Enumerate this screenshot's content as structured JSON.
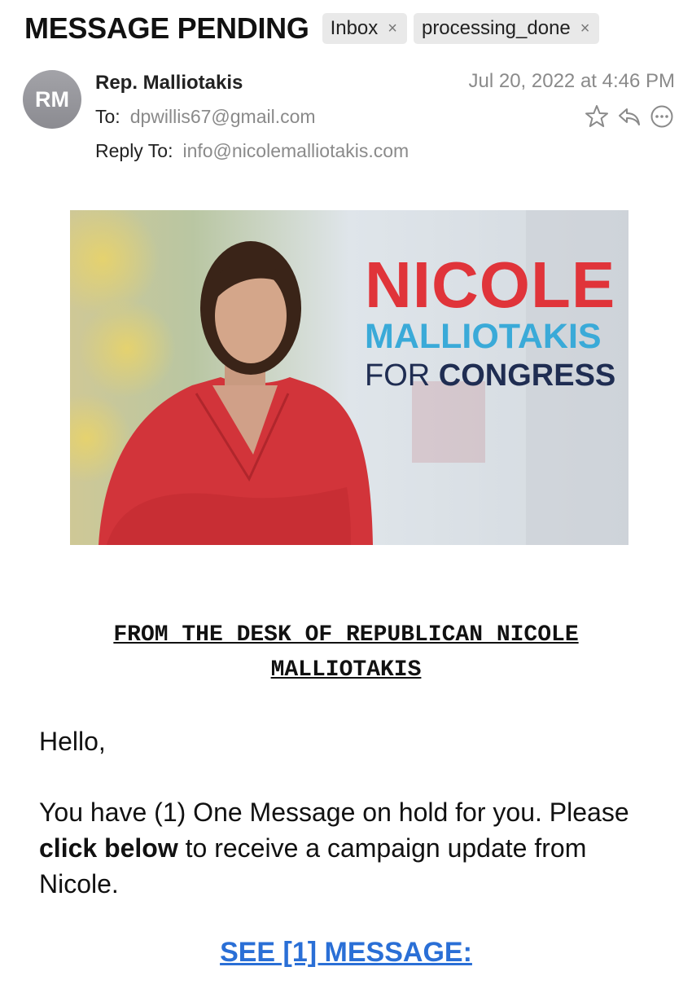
{
  "email": {
    "subject": "MESSAGE PENDING",
    "tags": [
      {
        "label": "Inbox"
      },
      {
        "label": "processing_done"
      }
    ],
    "tag_remove_glyph": "×",
    "avatar_initials": "RM",
    "sender": "Rep. Malliotakis",
    "date": "Jul 20, 2022 at 4:46 PM",
    "to_label": "To:",
    "to_value": "dpwillis67@gmail.com",
    "reply_to_label": "Reply To:",
    "reply_to_value": "info@nicolemalliotakis.com",
    "actions": [
      "star-icon",
      "reply-icon",
      "more-icon"
    ]
  },
  "banner": {
    "line1": "NICOLE",
    "line2": "MALLIOTAKIS",
    "line3_prefix": "FOR",
    "line3_bold": "CONGRESS",
    "colors": {
      "red": "#e0343a",
      "blue": "#3aaad8",
      "navy": "#1f2d52"
    }
  },
  "body": {
    "desk_heading": "FROM THE DESK OF REPUBLICAN NICOLE MALLIOTAKIS",
    "greeting": "Hello,",
    "para_1": "You have (1) One Message on hold for you. Please ",
    "para_bold": "click below",
    "para_2": " to receive a campaign update from Nicole.",
    "cta": "SEE [1] MESSAGE:",
    "link_color": "#2a6fd6"
  }
}
